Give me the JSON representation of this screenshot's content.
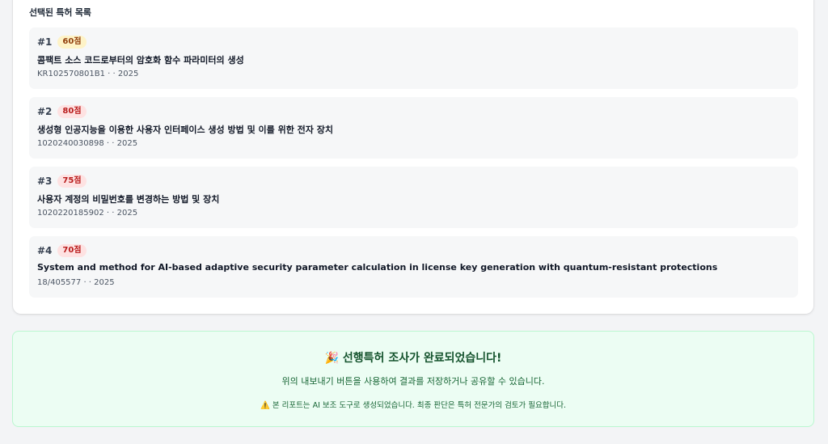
{
  "section": {
    "title": "선택된 특허 목록"
  },
  "patents": [
    {
      "number": "#1",
      "score": "60점",
      "badge_bg": "#fef3c7",
      "badge_fg": "#92400e",
      "title": "콤팩트 소스 코드로부터의 암호화 함수 파라미터의 생성",
      "meta": "KR102570801B1 · · 2025"
    },
    {
      "number": "#2",
      "score": "80점",
      "badge_bg": "#fee2e2",
      "badge_fg": "#b91c1c",
      "title": "생성형 인공지능을 이용한 사용자 인터페이스 생성 방법 및 이를 위한 전자 장치",
      "meta": "1020240030898 · · 2025"
    },
    {
      "number": "#3",
      "score": "75점",
      "badge_bg": "#fee2e2",
      "badge_fg": "#b91c1c",
      "title": "사용자 계정의 비밀번호를 변경하는 방법 및 장치",
      "meta": "1020220185902 · · 2025"
    },
    {
      "number": "#4",
      "score": "70점",
      "badge_bg": "#fee2e2",
      "badge_fg": "#b91c1c",
      "title": "System and method for AI-based adaptive security parameter calculation in license key generation with quantum-resistant protections",
      "meta": "18/405577 · · 2025"
    }
  ],
  "notice": {
    "emoji": "🎉",
    "title": "선행특허 조사가 완료되었습니다!",
    "description": "위의 내보내기 버튼을 사용하여 결과를 저장하거나 공유할 수 있습니다.",
    "warning_icon": "⚠️",
    "warning": "본 리포트는 AI 보조 도구로 생성되었습니다. 최종 판단은 특허 전문가의 검토가 필요합니다."
  },
  "colors": {
    "notice_bg": "#ecfdf3",
    "notice_border": "#bbf7d0",
    "notice_text": "#166534"
  }
}
